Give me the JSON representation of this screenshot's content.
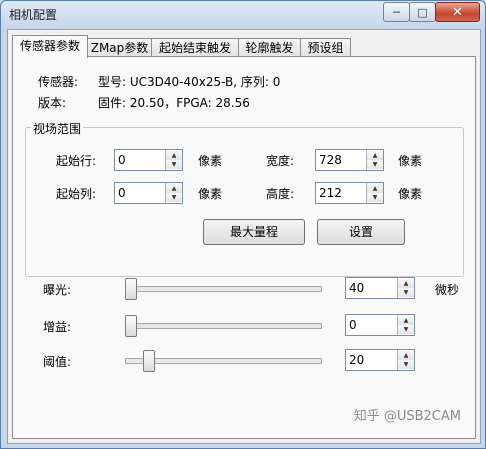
{
  "window": {
    "title": "相机配置",
    "minimize": "─",
    "maximize": "□",
    "close": "✕"
  },
  "tabs": [
    "传感器参数",
    "ZMap参数",
    "起始结束触发",
    "轮廓触发",
    "预设组"
  ],
  "sensor_info": {
    "sensor_label": "传感器:",
    "sensor_value": "型号: UC3D40-40x25-B, 序列: 0",
    "version_label": "版本:",
    "version_value": "固件: 20.50，FPGA: 28.56"
  },
  "fov": {
    "title": "视场范围",
    "start_row_label": "起始行:",
    "start_row": "0",
    "start_col_label": "起始列:",
    "start_col": "0",
    "width_label": "宽度:",
    "width": "728",
    "height_label": "高度:",
    "height": "212",
    "unit": "像素",
    "max_range_button": "最大量程",
    "set_button": "设置"
  },
  "sliders": {
    "exposure": {
      "label": "曝光:",
      "value": "40",
      "unit": "微秒",
      "level": 0.0
    },
    "gain": {
      "label": "增益:",
      "value": "0",
      "level": 0.0
    },
    "threshold": {
      "label": "阈值:",
      "value": "20",
      "level": 0.1
    }
  },
  "watermark": "知乎 @USB2CAM"
}
